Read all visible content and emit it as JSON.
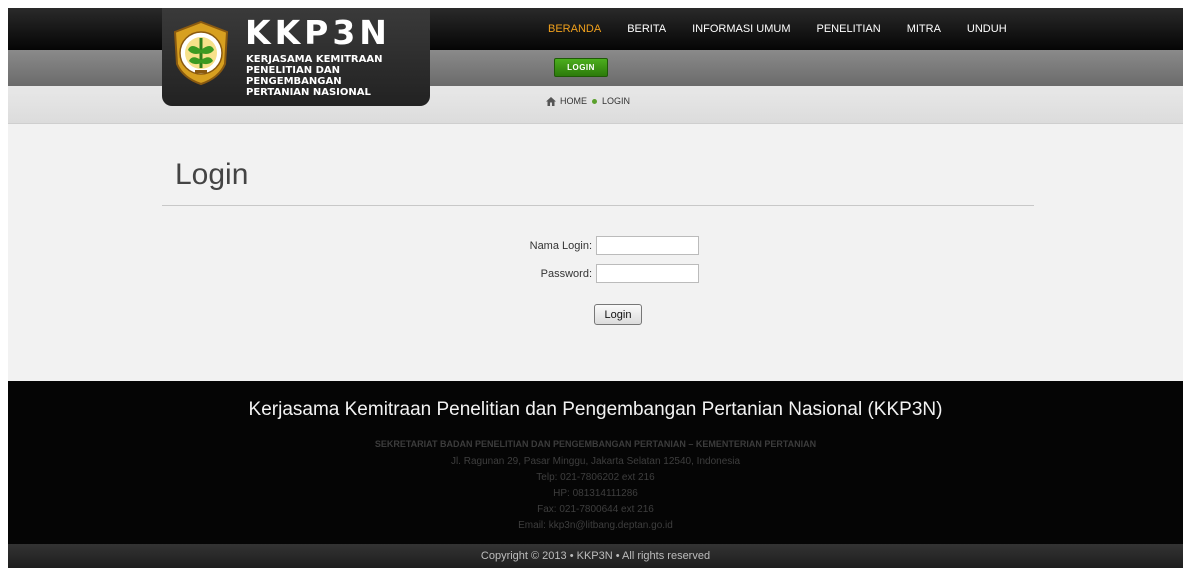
{
  "brand": {
    "title": "KKP3N",
    "subtitle_lines": [
      "KERJASAMA KEMITRAAN",
      "PENELITIAN DAN PENGEMBANGAN",
      "PERTANIAN NASIONAL"
    ],
    "logo_icon": "ministry-emblem-icon"
  },
  "nav": {
    "items": [
      {
        "label": "BERANDA",
        "active": true
      },
      {
        "label": "BERITA"
      },
      {
        "label": "INFORMASI UMUM"
      },
      {
        "label": "PENELITIAN"
      },
      {
        "label": "MITRA"
      },
      {
        "label": "UNDUH"
      }
    ]
  },
  "subnav": {
    "login_label": "LOGIN"
  },
  "breadcrumb": {
    "home_label": "HOME",
    "current_label": "LOGIN",
    "home_icon": "home-icon"
  },
  "page": {
    "title": "Login"
  },
  "form": {
    "username_label": "Nama Login:",
    "username_value": "",
    "password_label": "Password:",
    "password_value": "",
    "submit_label": "Login"
  },
  "footer": {
    "title": "Kerjasama Kemitraan Penelitian dan Pengembangan Pertanian Nasional (KKP3N)",
    "org": "SEKRETARIAT BADAN PENELITIAN DAN PENGEMBANGAN PERTANIAN – KEMENTERIAN PERTANIAN",
    "address": "Jl. Ragunan 29, Pasar Minggu, Jakarta Selatan 12540, Indonesia",
    "phone": "Telp: 021-7806202 ext 216",
    "mobile": "HP: 081314111286",
    "fax": "Fax: 021-7800644 ext 216",
    "email": "Email: kkp3n@litbang.deptan.go.id",
    "copyright": "Copyright © 2013 • KKP3N • All rights reserved"
  },
  "colors": {
    "accent": "#f0a01c",
    "login_green": "#3a9414",
    "footer_bg": "#050505"
  }
}
